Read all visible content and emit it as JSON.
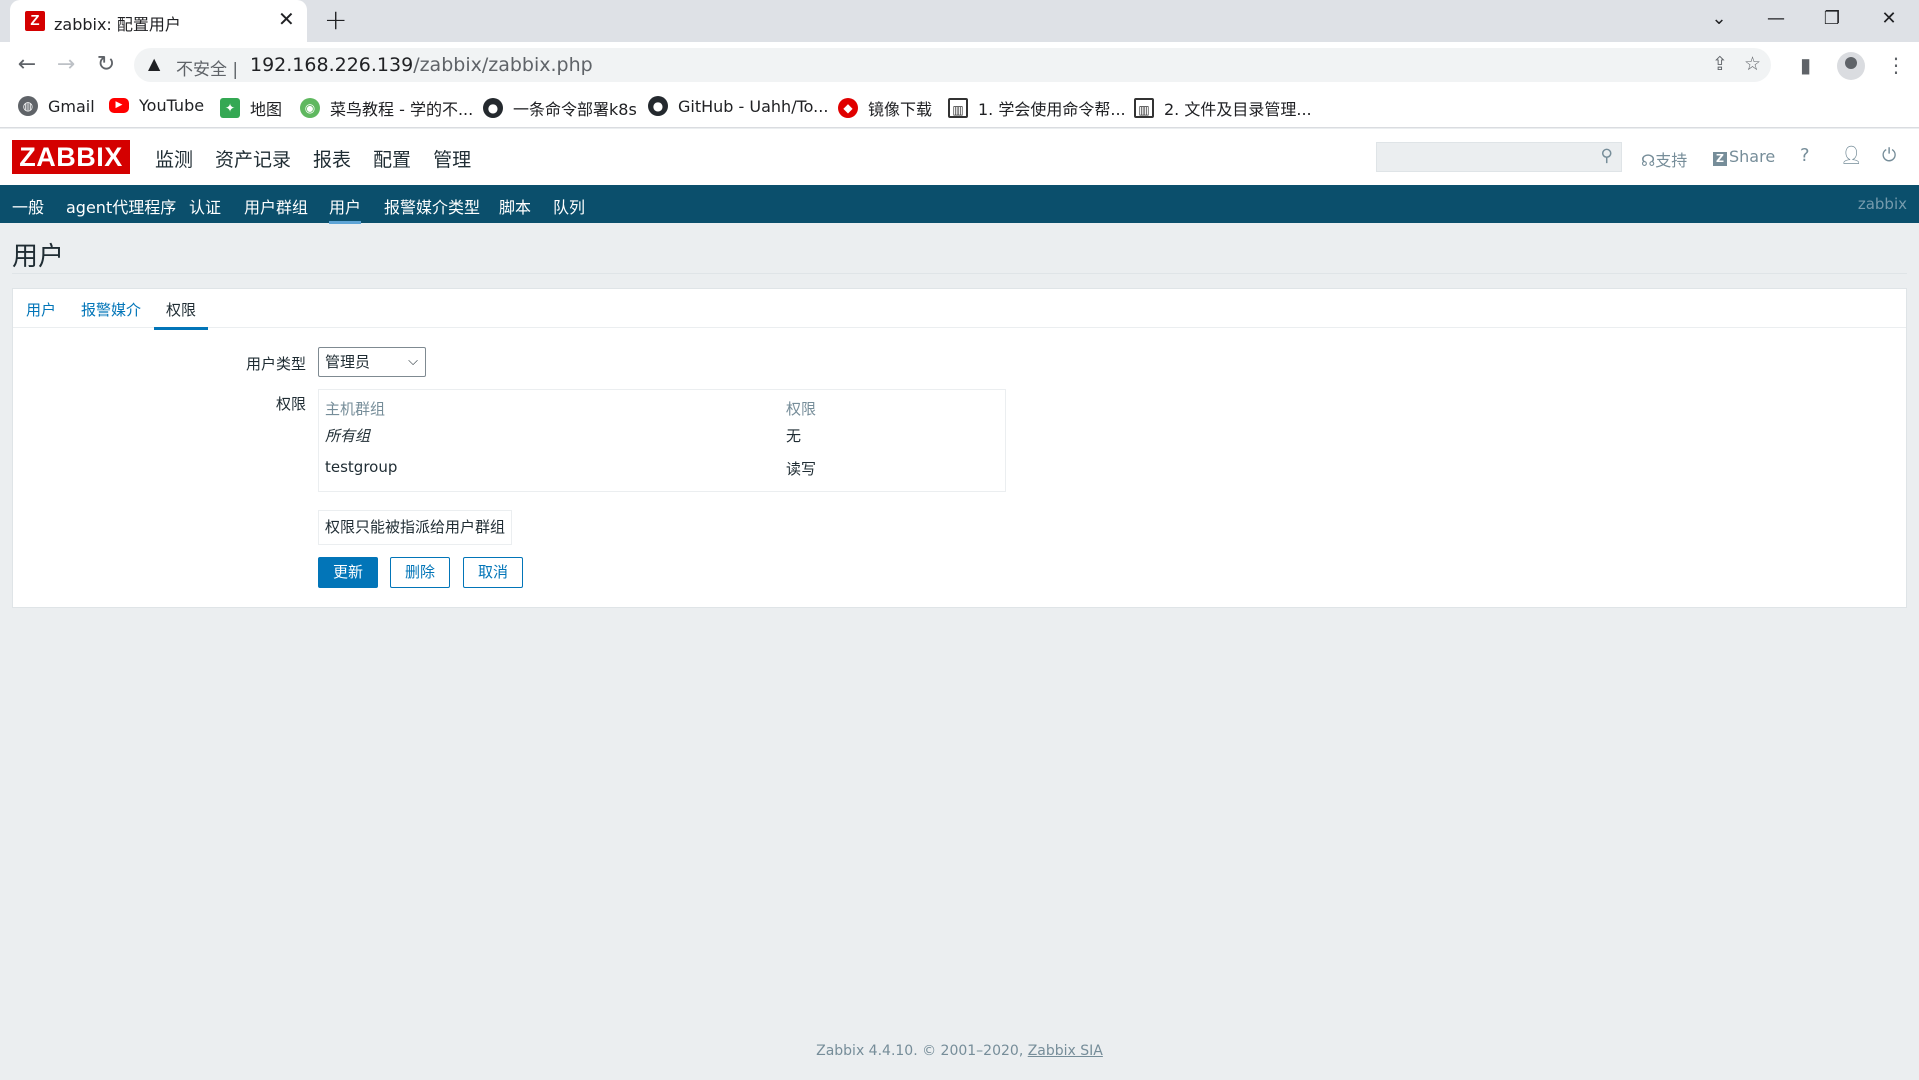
{
  "browser": {
    "tab_title": "zabbix: 配置用户",
    "tab_favicon": "Z",
    "tab_close": "✕",
    "new_tab": "+",
    "insecure_label": "不安全",
    "url_host": "192.168.226.139",
    "url_path": "/zabbix/zabbix.php",
    "bookmarks": [
      {
        "label": "Gmail",
        "icon": "globe-icon"
      },
      {
        "label": "YouTube",
        "icon": "youtube-icon"
      },
      {
        "label": "地图",
        "icon": "maps-icon"
      },
      {
        "label": "菜鸟教程 - 学的不...",
        "icon": "runoob-icon"
      },
      {
        "label": "一条命令部署k8s",
        "icon": "github-icon"
      },
      {
        "label": "GitHub - Uahh/To...",
        "icon": "github-icon"
      },
      {
        "label": "镜像下载",
        "icon": "redhat-icon"
      },
      {
        "label": "1. 学会使用命令帮...",
        "icon": "book-icon"
      },
      {
        "label": "2. 文件及目录管理...",
        "icon": "book-icon"
      }
    ]
  },
  "zabbix": {
    "logo": "ZABBIX",
    "main_nav": [
      "监测",
      "资产记录",
      "报表",
      "配置",
      "管理"
    ],
    "active_main": "管理",
    "search_value": "",
    "support_label": "支持",
    "share_label": "Share",
    "help_label": "?",
    "sub_nav": [
      "一般",
      "agent代理程序",
      "认证",
      "用户群组",
      "用户",
      "报警媒介类型",
      "脚本",
      "队列"
    ],
    "active_sub": "用户",
    "server_name": "zabbix"
  },
  "page": {
    "title": "用户",
    "tabs": [
      "用户",
      "报警媒介",
      "权限"
    ],
    "active_tab": "权限",
    "user_type_label": "用户类型",
    "user_type_value": "管理员",
    "permissions_label": "权限",
    "perm_headers": {
      "group": "主机群组",
      "permission": "权限"
    },
    "perm_rows": [
      {
        "group": "所有组",
        "permission": "无"
      },
      {
        "group": "testgroup",
        "permission": "读写"
      }
    ],
    "perm_note": "权限只能被指派给用户群组",
    "buttons": {
      "update": "更新",
      "delete": "删除",
      "cancel": "取消"
    }
  },
  "footer": {
    "text": "Zabbix 4.4.10. © 2001–2020,",
    "link": "Zabbix SIA"
  },
  "colors": {
    "brand_red": "#d40000",
    "nav_blue": "#0b4f6c",
    "link_blue": "#0275b8"
  }
}
